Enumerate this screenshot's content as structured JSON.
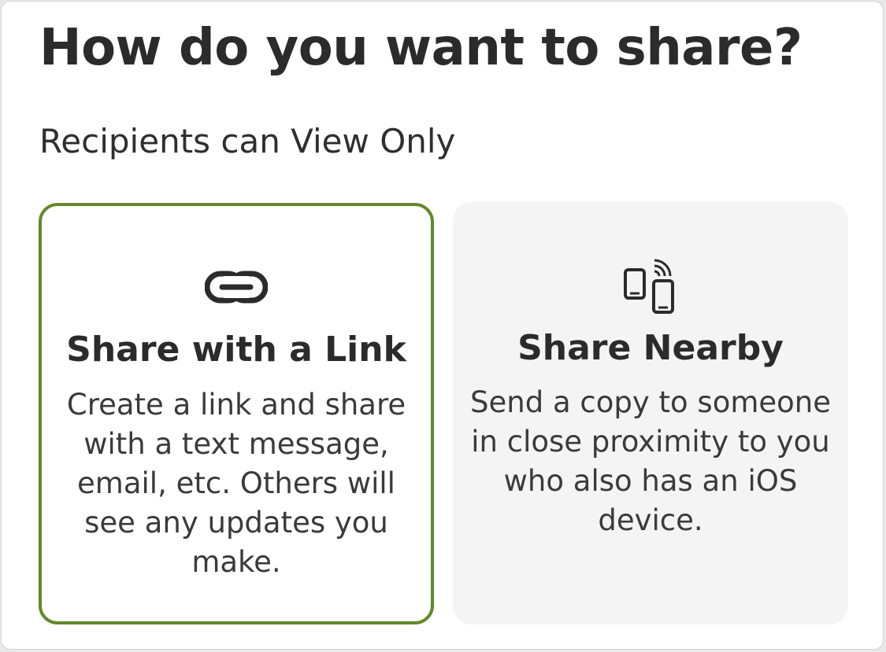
{
  "dialog": {
    "title": "How do you want to share?",
    "subtitle": "Recipients can View Only"
  },
  "options": [
    {
      "icon": "link-icon",
      "title": "Share with a Link",
      "description": "Create a link and share with a text message, email, etc. Others will see any updates you make.",
      "selected": true
    },
    {
      "icon": "phones-nearby-icon",
      "title": "Share Nearby",
      "description": "Send a copy to someone in close proximity to you who also has an iOS device.",
      "selected": false
    }
  ],
  "colors": {
    "selected_border": "#63892a",
    "unselected_background": "#f4f4f4",
    "text": "#2b2b2b"
  }
}
